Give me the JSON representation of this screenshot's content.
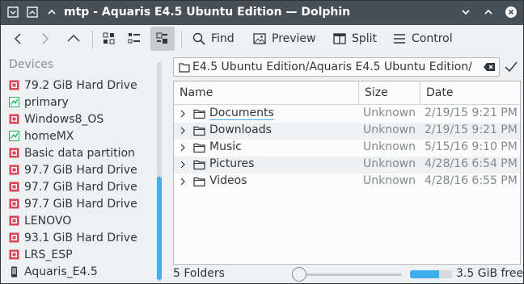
{
  "window": {
    "title": "mtp - Aquaris E4.5 Ubuntu Edition — Dolphin"
  },
  "toolbar": {
    "find_label": "Find",
    "preview_label": "Preview",
    "split_label": "Split",
    "control_label": "Control"
  },
  "sidebar": {
    "section_title": "Devices",
    "items": [
      {
        "label": "79.2 GiB Hard Drive",
        "icon": "hard-drive-icon"
      },
      {
        "label": "primary",
        "icon": "partition-icon"
      },
      {
        "label": "Windows8_OS",
        "icon": "hard-drive-icon"
      },
      {
        "label": "homeMX",
        "icon": "partition-icon"
      },
      {
        "label": "Basic data partition",
        "icon": "hard-drive-icon"
      },
      {
        "label": "97.7 GiB Hard Drive",
        "icon": "hard-drive-icon"
      },
      {
        "label": "97.7 GiB Hard Drive",
        "icon": "hard-drive-icon"
      },
      {
        "label": "97.7 GiB Hard Drive",
        "icon": "hard-drive-icon"
      },
      {
        "label": "LENOVO",
        "icon": "hard-drive-icon"
      },
      {
        "label": "93.1 GiB Hard Drive",
        "icon": "hard-drive-icon"
      },
      {
        "label": "LRS_ESP",
        "icon": "hard-drive-icon"
      },
      {
        "label": "Aquaris_E4.5",
        "icon": "phone-icon"
      }
    ]
  },
  "location": {
    "path": "E4.5 Ubuntu Edition/Aquaris E4.5 Ubuntu Edition/"
  },
  "columns": {
    "name": "Name",
    "size": "Size",
    "date": "Date"
  },
  "files": [
    {
      "name": "Documents",
      "size": "Unknown",
      "date": "2/19/15 9:21 PM"
    },
    {
      "name": "Downloads",
      "size": "Unknown",
      "date": "2/19/15 9:21 PM"
    },
    {
      "name": "Music",
      "size": "Unknown",
      "date": "5/15/16 9:10 PM"
    },
    {
      "name": "Pictures",
      "size": "Unknown",
      "date": "4/28/16 6:54 PM"
    },
    {
      "name": "Videos",
      "size": "Unknown",
      "date": "4/28/16 6:55 PM"
    }
  ],
  "status": {
    "summary": "5 Folders",
    "free_space": "3.5 GiB free",
    "free_fraction": 0.7
  },
  "colors": {
    "accent": "#3daee9",
    "titlebar": "#475057",
    "drive_icon": "#da4453",
    "partition_icon": "#27ae60"
  }
}
